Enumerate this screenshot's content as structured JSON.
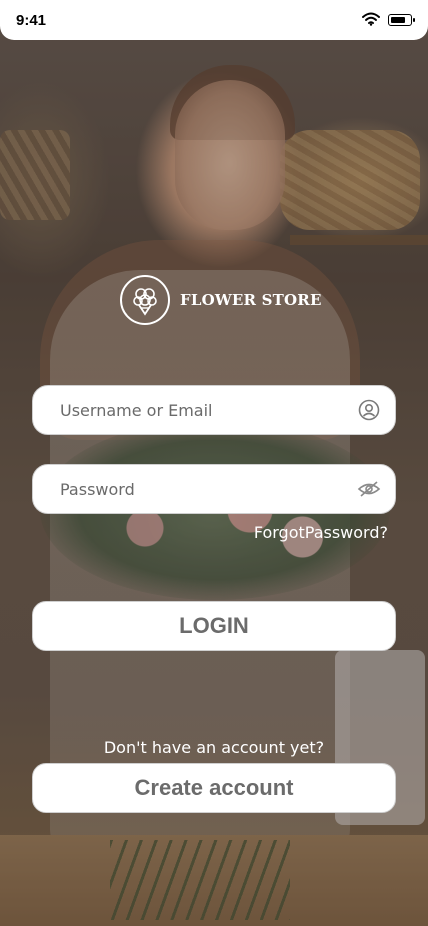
{
  "status_bar": {
    "time": "9:41",
    "wifi_icon": "wifi-icon",
    "battery_icon": "battery-icon"
  },
  "brand": {
    "logo_icon": "flower-bouquet-icon",
    "name": "FLOWER STORE"
  },
  "form": {
    "username": {
      "placeholder": "Username or Email",
      "value": "",
      "icon": "user-circle-icon"
    },
    "password": {
      "placeholder": "Password",
      "value": "",
      "icon": "eye-off-icon"
    },
    "forgot_password": "ForgotPassword?",
    "login_label": "LOGIN"
  },
  "signup": {
    "prompt": "Don't have an account yet?",
    "create_label": "Create account"
  },
  "colors": {
    "button_text": "#6b6b6b",
    "field_bg": "#ffffff",
    "overlay_text": "#ffffff"
  }
}
